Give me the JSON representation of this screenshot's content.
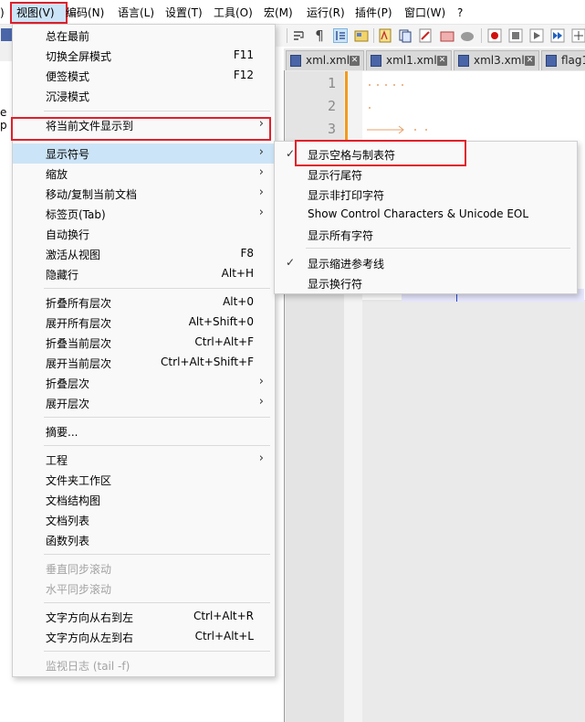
{
  "menubar": {
    "items": [
      "视图(V)",
      "编码(N)",
      "语言(L)",
      "设置(T)",
      "工具(O)",
      "宏(M)",
      "运行(R)",
      "插件(P)",
      "窗口(W)",
      "?"
    ],
    "left_edge": ")"
  },
  "side_text": "e p",
  "tabs": [
    {
      "label": "xml.xml"
    },
    {
      "label": "xml1.xml"
    },
    {
      "label": "xml3.xml"
    },
    {
      "label": "flag1"
    }
  ],
  "editor": {
    "line_numbers": [
      "1",
      "2",
      "3"
    ]
  },
  "view_menu": {
    "items": [
      {
        "label": "总在最前",
        "shortcut": ""
      },
      {
        "label": "切换全屏模式",
        "shortcut": "F11"
      },
      {
        "label": "便签模式",
        "shortcut": "F12"
      },
      {
        "label": "沉浸模式",
        "shortcut": ""
      },
      {
        "label": "将当前文件显示到",
        "shortcut": ""
      },
      {
        "label": "显示符号",
        "shortcut": ""
      },
      {
        "label": "缩放",
        "shortcut": ""
      },
      {
        "label": "移动/复制当前文档",
        "shortcut": ""
      },
      {
        "label": "标签页(Tab)",
        "shortcut": ""
      },
      {
        "label": "自动换行",
        "shortcut": ""
      },
      {
        "label": "激活从视图",
        "shortcut": "F8"
      },
      {
        "label": "隐藏行",
        "shortcut": "Alt+H"
      },
      {
        "label": "折叠所有层次",
        "shortcut": "Alt+0"
      },
      {
        "label": "展开所有层次",
        "shortcut": "Alt+Shift+0"
      },
      {
        "label": "折叠当前层次",
        "shortcut": "Ctrl+Alt+F"
      },
      {
        "label": "展开当前层次",
        "shortcut": "Ctrl+Alt+Shift+F"
      },
      {
        "label": "折叠层次",
        "shortcut": ""
      },
      {
        "label": "展开层次",
        "shortcut": ""
      },
      {
        "label": "摘要...",
        "shortcut": ""
      },
      {
        "label": "工程",
        "shortcut": ""
      },
      {
        "label": "文件夹工作区",
        "shortcut": ""
      },
      {
        "label": "文档结构图",
        "shortcut": ""
      },
      {
        "label": "文档列表",
        "shortcut": ""
      },
      {
        "label": "函数列表",
        "shortcut": ""
      },
      {
        "label": "垂直同步滚动",
        "shortcut": ""
      },
      {
        "label": "水平同步滚动",
        "shortcut": ""
      },
      {
        "label": "文字方向从右到左",
        "shortcut": "Ctrl+Alt+R"
      },
      {
        "label": "文字方向从左到右",
        "shortcut": "Ctrl+Alt+L"
      },
      {
        "label": "监视日志 (tail -f)",
        "shortcut": ""
      }
    ]
  },
  "symbol_submenu": {
    "items": [
      {
        "label": "显示空格与制表符",
        "checked": true
      },
      {
        "label": "显示行尾符",
        "checked": false
      },
      {
        "label": "显示非打印字符",
        "checked": false
      },
      {
        "label": "Show Control Characters & Unicode EOL",
        "checked": false
      },
      {
        "label": "显示所有字符",
        "checked": false
      },
      {
        "label": "显示缩进参考线",
        "checked": true
      },
      {
        "label": "显示换行符",
        "checked": false
      }
    ],
    "check_glyph": "✓"
  },
  "glyphs": {
    "submenu_arrow": "›",
    "tab_close": "✕",
    "pilcrow": "¶"
  },
  "colors": {
    "highlight_box": "#e0202a",
    "menu_hover": "#cce4f7",
    "fold_margin": "#f39a1e"
  }
}
